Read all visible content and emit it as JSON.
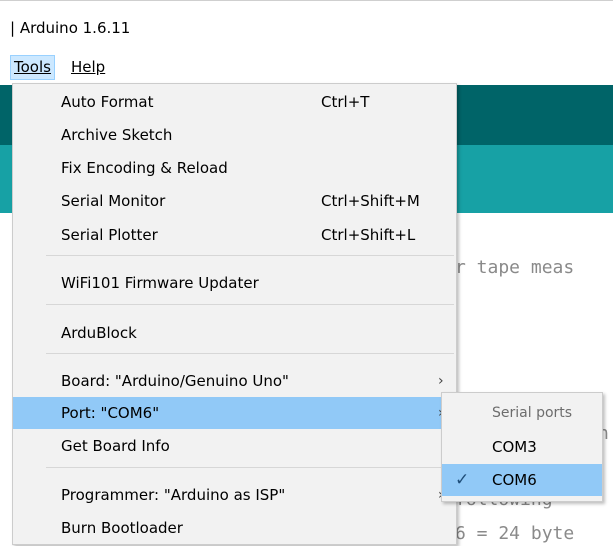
{
  "window": {
    "title": "| Arduino 1.6.11"
  },
  "menubar": {
    "tools": "Tools",
    "help": "Help"
  },
  "tools_menu": {
    "items": [
      {
        "label": "Auto Format",
        "shortcut": "Ctrl+T"
      },
      {
        "label": "Archive Sketch",
        "shortcut": ""
      },
      {
        "label": "Fix Encoding & Reload",
        "shortcut": ""
      },
      {
        "label": "Serial Monitor",
        "shortcut": "Ctrl+Shift+M"
      },
      {
        "label": "Serial Plotter",
        "shortcut": "Ctrl+Shift+L"
      },
      {
        "label": "WiFi101 Firmware Updater",
        "shortcut": ""
      },
      {
        "label": "ArduBlock",
        "shortcut": ""
      },
      {
        "label": "Board: \"Arduino/Genuino Uno\"",
        "arrow": "›"
      },
      {
        "label": "Port: \"COM6\"",
        "arrow": "›",
        "highlighted": true
      },
      {
        "label": "Get Board Info",
        "shortcut": ""
      },
      {
        "label": "Programmer: \"Arduino as ISP\"",
        "arrow": "›"
      },
      {
        "label": "Burn Bootloader",
        "shortcut": ""
      }
    ]
  },
  "ports_menu": {
    "header": "Serial ports",
    "items": [
      {
        "label": "COM3",
        "checked": false
      },
      {
        "label": "COM6",
        "checked": true
      }
    ],
    "check_glyph": "✓"
  },
  "editor": {
    "code_lines": [
      "r tape meas",
      "n",
      "following",
      "6 = 24 byte"
    ]
  },
  "colors": {
    "highlight": "#91c9f7",
    "editor_header_dark": "#006468",
    "editor_header_light": "#17a1a5"
  }
}
